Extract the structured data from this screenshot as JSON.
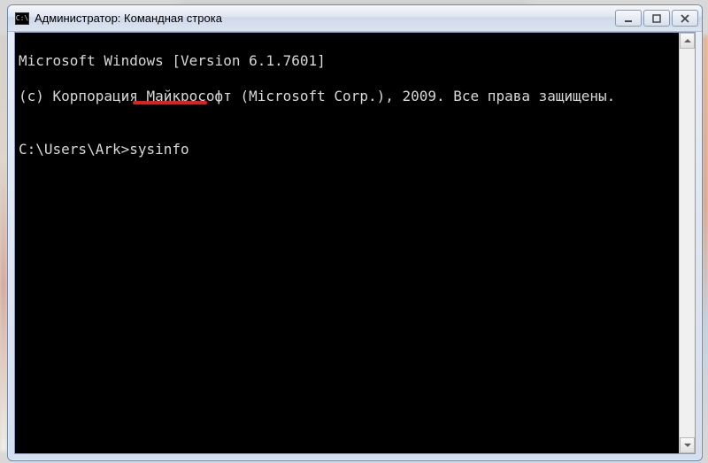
{
  "window": {
    "title": "Администратор: Командная строка",
    "icon_label": "C:\\"
  },
  "terminal": {
    "line1": "Microsoft Windows [Version 6.1.7601]",
    "line2": "(c) Корпорация Майкрософт (Microsoft Corp.), 2009. Все права защищены.",
    "blank": "",
    "prompt": "C:\\Users\\Ark>",
    "command": "sysinfo"
  },
  "controls": {
    "minimize": "minimize",
    "maximize": "maximize",
    "close": "close"
  },
  "annotation": {
    "underline_color": "#e02020"
  }
}
